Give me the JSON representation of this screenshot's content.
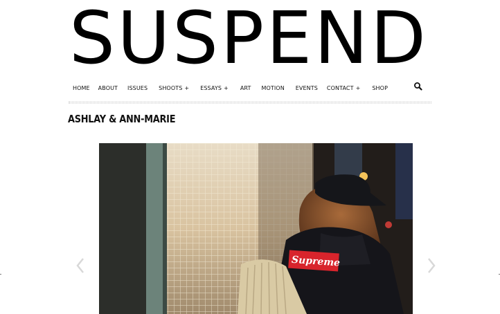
{
  "site": {
    "logo_text": "SUSPEND"
  },
  "nav": {
    "items": [
      {
        "label": "HOME",
        "has_submenu": false
      },
      {
        "label": "ABOUT",
        "has_submenu": false
      },
      {
        "label": "ISSUES",
        "has_submenu": false
      },
      {
        "label": "SHOOTS",
        "has_submenu": true
      },
      {
        "label": "ESSAYS",
        "has_submenu": true
      },
      {
        "label": "ART",
        "has_submenu": false
      },
      {
        "label": "MOTION",
        "has_submenu": false
      },
      {
        "label": "EVENTS",
        "has_submenu": false
      },
      {
        "label": "CONTACT",
        "has_submenu": true
      },
      {
        "label": "SHOP",
        "has_submenu": false
      }
    ],
    "submenu_marker": "+",
    "search_icon": "search-icon"
  },
  "post": {
    "title": "ASHLAY & ANN-MARIE",
    "photo_patch_text": "Supreme",
    "slider": {
      "prev_icon": "chevron-left-icon",
      "next_icon": "chevron-right-icon"
    }
  },
  "colors": {
    "text": "#111111",
    "divider": "#b8b8b8",
    "slider_arrow": "#d8d8d8",
    "patch_red": "#d8242c"
  }
}
